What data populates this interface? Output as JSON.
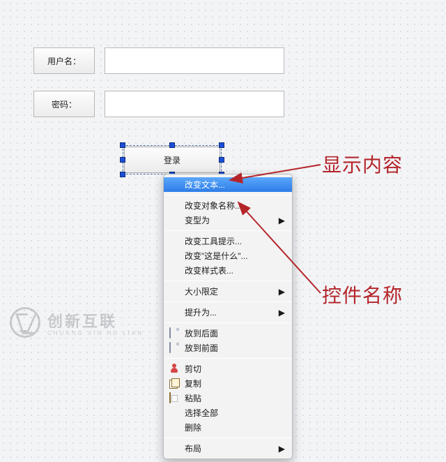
{
  "form": {
    "username_label": "用户名：",
    "username_value": "",
    "password_label": "密码：",
    "password_value": "",
    "login_label": "登录"
  },
  "annotations": {
    "display_content": "显示内容",
    "widget_name": "控件名称"
  },
  "context_menu": {
    "items": [
      {
        "label": "改变文本...",
        "highlighted": true
      },
      {
        "label": "改变对象名称..."
      },
      {
        "label": "变型为",
        "submenu": true
      },
      {
        "label": "改变工具提示..."
      },
      {
        "label": "改变\"这是什么\"..."
      },
      {
        "label": "改变样式表..."
      },
      {
        "label": "大小限定",
        "submenu": true
      },
      {
        "label": "提升为...",
        "submenu": true
      },
      {
        "label": "放到后面",
        "icon": "page-back"
      },
      {
        "label": "放到前面",
        "icon": "page-front"
      },
      {
        "label": "剪切",
        "icon": "cut"
      },
      {
        "label": "复制",
        "icon": "copy"
      },
      {
        "label": "粘贴",
        "icon": "paste"
      },
      {
        "label": "选择全部"
      },
      {
        "label": "删除"
      },
      {
        "label": "布局",
        "submenu": true
      }
    ]
  },
  "watermark": {
    "cn": "创新互联",
    "en": "CHUANG XIN HU LIAN"
  }
}
